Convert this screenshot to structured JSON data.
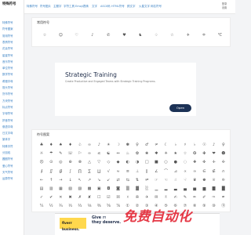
{
  "logo": "特殊符号",
  "sidebar": {
    "items": [
      "特殊符号",
      "符号图案",
      "常用符号",
      "表情符号",
      "花朵符号",
      "星星符号",
      "音乐符号",
      "单位符号",
      "数学符号",
      "希腊字母",
      "箭头符号",
      "货币符号",
      "方块符号",
      "标点符号",
      "字母符号",
      "拼音符号",
      "俄语字母",
      "日文字母",
      "繁体字",
      "特殊字符",
      "分割线",
      "圆圈符号",
      "爱心符号",
      "天气符号",
      "运算符号"
    ]
  },
  "topnav": {
    "items": [
      "特殊符号",
      "符号图片",
      "主题字",
      "字符工具",
      "Emoji表情",
      "文字",
      "ASCII码",
      "HTML符号",
      "颜文字",
      "火星文字",
      "网名符号"
    ],
    "right_top": "登录",
    "right_bottom": "设置"
  },
  "common_symbols": {
    "title": "常用符号",
    "symbols": [
      "☆",
      "☺",
      "♡",
      "♪",
      "✆",
      "♥",
      "♞",
      "♢",
      "☆",
      "✈",
      "✡",
      "℃"
    ]
  },
  "ad": {
    "title": "Strategic Training",
    "subtitle": "Create Productive and Engaged Teams with Strategic Training Programs.",
    "button": "Open"
  },
  "symbol_art": {
    "title": "符号图案",
    "rows": [
      [
        "♣",
        "♦",
        "♠",
        "♦",
        "♧",
        "∞",
        "♪",
        "☀",
        "☽",
        "✽",
        "♀",
        "♂",
        "≠",
        "☾",
        "♭",
        "♯",
        "♭",
        "☉",
        "♪",
        "♀"
      ],
      [
        "☼",
        "☂",
        "✎",
        "☏",
        "⚐",
        "∞",
        "≤",
        "☯",
        "↔",
        "♨",
        "✿",
        "❀",
        "✱",
        "✳",
        "★",
        "☆",
        "✪",
        "✤",
        "❤",
        "☻"
      ],
      [
        "☹",
        "⊙",
        "◎",
        "⊕",
        "⊗",
        "△",
        "▽",
        "◇",
        "◆",
        "◐",
        "◑",
        "□",
        "■",
        "○",
        "●",
        "◌",
        "✚",
        "✜",
        "✛",
        "✢"
      ],
      [
        "∮",
        "∬",
        "∯",
        "∫",
        "∏",
        "∑",
        "∐",
        "√",
        "≈",
        "≡",
        "⊥",
        "∥",
        "∠",
        "⌒",
        "⊿",
        "∝",
        "∞",
        "∈",
        "∉",
        "∩"
      ],
      [
        "←",
        "↑",
        "→",
        "↓",
        "↖",
        "↗",
        "↘",
        "↙",
        "⇄",
        "⇆",
        "⇅",
        "⇌",
        "☞",
        "☜",
        "☝",
        "☟",
        "♛",
        "♚",
        "♕",
        "♔"
      ],
      [
        "▤",
        "▥",
        "▦",
        "▧",
        "▨",
        "▩",
        "▣",
        "◘",
        "◙",
        "▒",
        "▓",
        "░",
        "▁",
        "▂",
        "▃",
        "▄",
        "▅",
        "▆",
        "▇",
        "█"
      ],
      [
        "✓",
        "✔",
        "✕",
        "✖",
        "✗",
        "✘",
        "☐",
        "☑",
        "☒",
        "☓",
        "✇",
        "✈",
        "✉",
        "✌",
        "✍",
        "✎",
        "✏",
        "✐",
        "✑",
        "✒"
      ],
      [
        "¼",
        "½",
        "¾",
        "⅓",
        "⅔",
        "⅛",
        "⅜",
        "⅝",
        "⅞",
        "①",
        "②",
        "③",
        "④",
        "⑤",
        "⑥",
        "⑦",
        "⑧",
        "⑨",
        "⑩",
        "⑪"
      ]
    ]
  },
  "banner": {
    "brand": "fiverr business.",
    "text_bold": "Give",
    "text_italic": "m",
    "text_line2": "they deserve.",
    "overlay": "免费自动化"
  },
  "colors": {
    "accent": "#3b82c4",
    "ad_button": "#1c3256",
    "overlay_red": "#e53946",
    "fiverr_yellow": "#ffd84d"
  }
}
